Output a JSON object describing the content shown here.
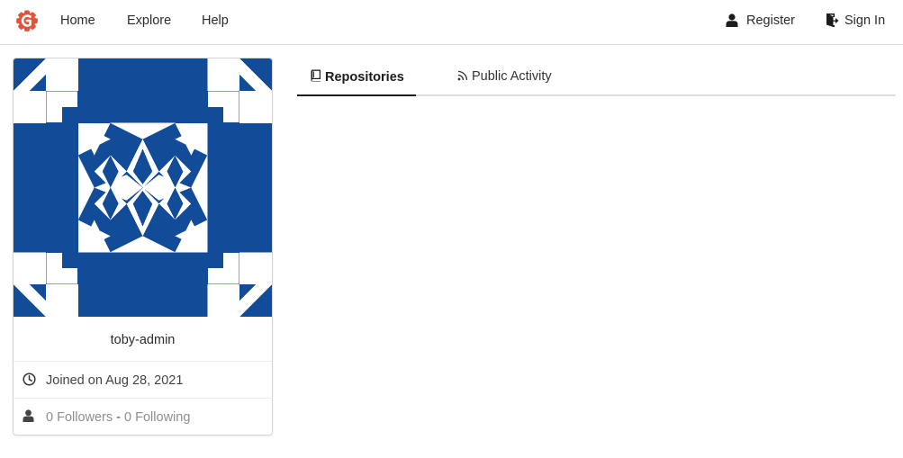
{
  "header": {
    "nav": {
      "home": "Home",
      "explore": "Explore",
      "help": "Help"
    },
    "auth": {
      "register": "Register",
      "sign_in": "Sign In"
    },
    "icons": {
      "logo": "gitea-logo",
      "register": "user-icon",
      "sign_in": "sign-in-icon"
    }
  },
  "profile": {
    "username": "toby-admin",
    "joined": "Joined on Aug 28, 2021",
    "followers": "0 Followers",
    "separator": "-",
    "following": "0 Following",
    "icons": {
      "joined": "clock-icon",
      "follow": "person-icon"
    }
  },
  "tabs": [
    {
      "label": "Repositories",
      "icon": "book-icon",
      "active": true
    },
    {
      "label": "Public Activity",
      "icon": "rss-icon",
      "active": false
    }
  ],
  "colors": {
    "avatar": "#124b97",
    "logo": "#e0533a",
    "text": "#2c2c2c",
    "muted": "#8e8e8e"
  }
}
